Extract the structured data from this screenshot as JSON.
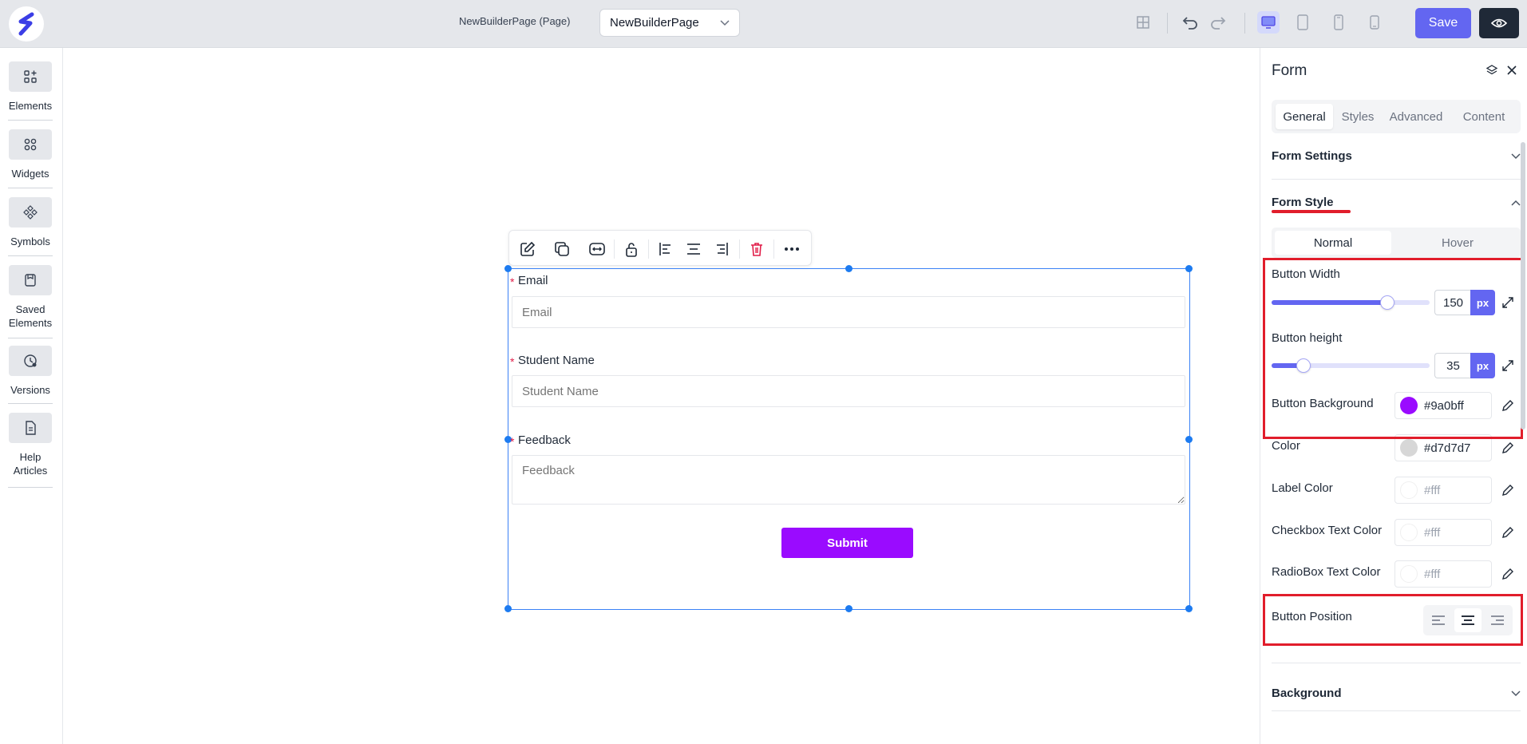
{
  "topbar": {
    "page_label": "NewBuilderPage (Page)",
    "page_select_value": "NewBuilderPage",
    "save_label": "Save"
  },
  "leftbar": {
    "items": [
      {
        "label": "Elements",
        "icon": "elements-icon"
      },
      {
        "label": "Widgets",
        "icon": "widgets-icon"
      },
      {
        "label": "Symbols",
        "icon": "symbols-icon"
      },
      {
        "label": "Saved Elements",
        "icon": "saved-elements-icon"
      },
      {
        "label": "Versions",
        "icon": "versions-icon"
      },
      {
        "label": "Help Articles",
        "icon": "help-articles-icon"
      }
    ]
  },
  "form": {
    "fields": [
      {
        "label": "Email",
        "required_mark": "*",
        "placeholder": "Email"
      },
      {
        "label": "Student Name",
        "required_mark": "*",
        "placeholder": "Student Name"
      },
      {
        "label": "Feedback",
        "required_mark": "*",
        "placeholder": "Feedback"
      }
    ],
    "submit_label": "Submit"
  },
  "panel": {
    "title": "Form",
    "tabs": [
      "General",
      "Styles",
      "Advanced",
      "Content"
    ],
    "active_tab": "General",
    "sections": {
      "form_settings": "Form Settings",
      "form_style": "Form Style",
      "background": "Background"
    },
    "state_toggle": {
      "normal": "Normal",
      "hover": "Hover",
      "active": "Normal"
    },
    "button_width": {
      "label": "Button Width",
      "value": "150",
      "unit": "px",
      "slider_fraction": 0.73
    },
    "button_height": {
      "label": "Button height",
      "value": "35",
      "unit": "px",
      "slider_fraction": 0.2
    },
    "button_background": {
      "label": "Button Background",
      "value": "#9a0bff"
    },
    "color": {
      "label": "Color",
      "value": "#d7d7d7"
    },
    "label_color": {
      "label": "Label Color",
      "value": "#fff"
    },
    "checkbox_text_color": {
      "label": "Checkbox Text Color",
      "value": "#fff"
    },
    "radiobox_text_color": {
      "label": "RadioBox Text Color",
      "value": "#fff"
    },
    "button_position": {
      "label": "Button Position",
      "active": "center"
    }
  },
  "colors": {
    "accent": "#6366f1",
    "submit_bg": "#9a0bff",
    "highlight": "#e11d2b",
    "selection": "#3b82f6"
  }
}
